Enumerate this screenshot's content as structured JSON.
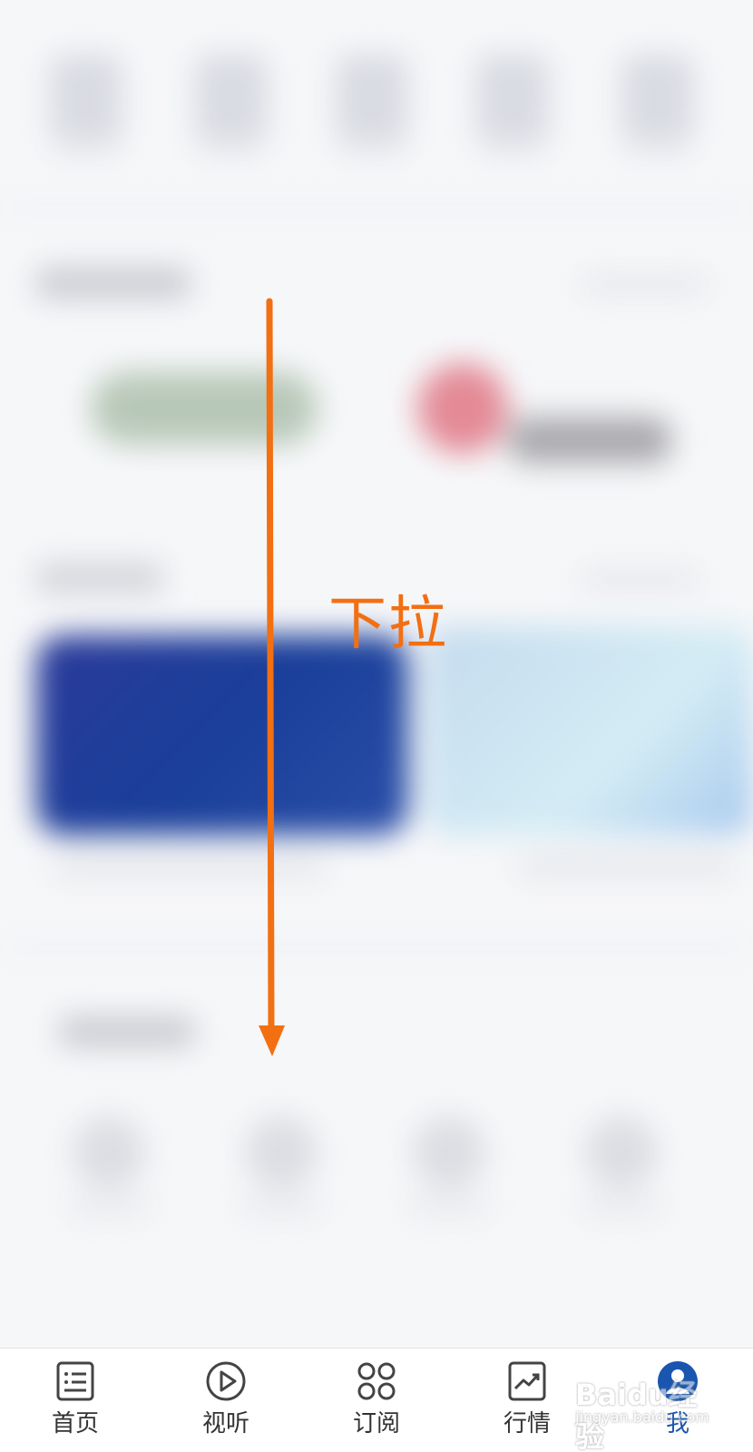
{
  "overlay": {
    "hint_text": "下拉",
    "accent_color": "#f26f12"
  },
  "tab_bar": {
    "active_color": "#1a56b0",
    "tabs": [
      {
        "label": "首页",
        "icon": "news-list-icon",
        "active": false
      },
      {
        "label": "视听",
        "icon": "play-circle-icon",
        "active": false
      },
      {
        "label": "订阅",
        "icon": "four-circles-icon",
        "active": false
      },
      {
        "label": "行情",
        "icon": "trend-chart-icon",
        "active": false
      },
      {
        "label": "我",
        "icon": "user-avatar-icon",
        "active": true
      }
    ]
  },
  "watermark": {
    "logo_text": "Baidu经验",
    "url_text": "jingyan.baidu.com"
  }
}
